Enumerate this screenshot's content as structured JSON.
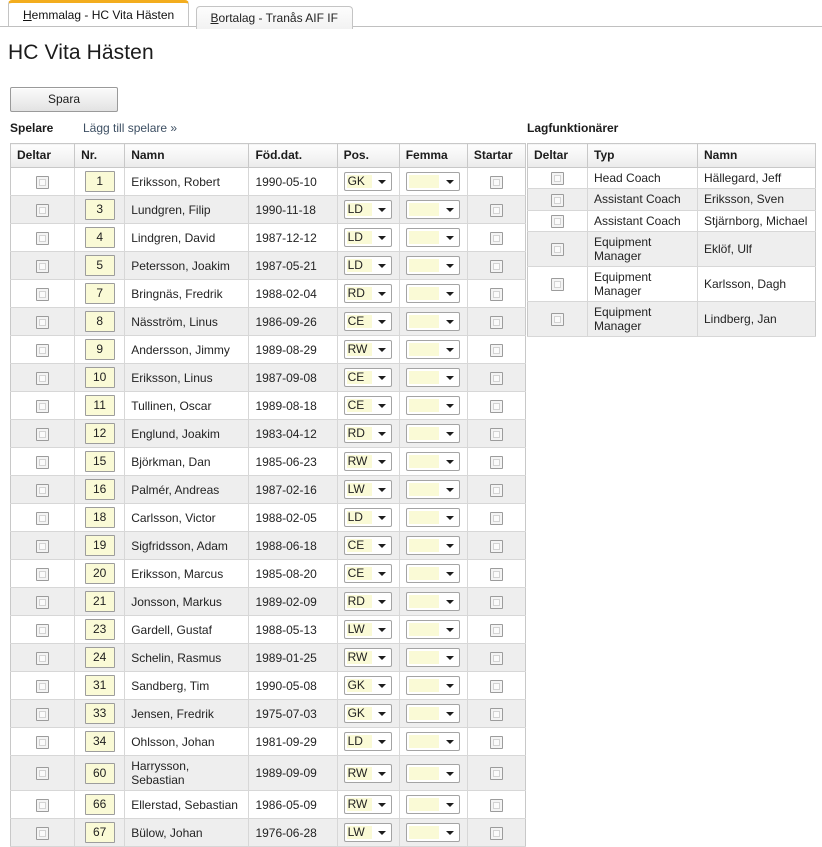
{
  "tabs": [
    {
      "name": "tab-home-team",
      "mnemonic": "H",
      "rest": "emmalag - HC Vita Hästen",
      "label": "Hemmalag - HC Vita Hästen",
      "active": true
    },
    {
      "name": "tab-away-team",
      "mnemonic": "B",
      "rest": "ortalag - Tranås AIF IF",
      "label": "Bortalag - Tranås AIF IF",
      "active": false
    }
  ],
  "page": {
    "title": "HC Vita Hästen",
    "save_label": "Spara",
    "players_heading": "Spelare",
    "add_player_link": "Lägg till spelare »",
    "officials_heading": "Lagfunktionärer"
  },
  "players_table": {
    "columns": [
      "Deltar",
      "Nr.",
      "Namn",
      "Föd.dat.",
      "Pos.",
      "Femma",
      "Startar"
    ],
    "rows": [
      {
        "nr": "1",
        "namn": "Eriksson, Robert",
        "fod": "1990-05-10",
        "pos": "GK",
        "femma": "",
        "deltar": false,
        "startar": false
      },
      {
        "nr": "3",
        "namn": "Lundgren, Filip",
        "fod": "1990-11-18",
        "pos": "LD",
        "femma": "",
        "deltar": false,
        "startar": false
      },
      {
        "nr": "4",
        "namn": "Lindgren, David",
        "fod": "1987-12-12",
        "pos": "LD",
        "femma": "",
        "deltar": false,
        "startar": false
      },
      {
        "nr": "5",
        "namn": "Petersson, Joakim",
        "fod": "1987-05-21",
        "pos": "LD",
        "femma": "",
        "deltar": false,
        "startar": false
      },
      {
        "nr": "7",
        "namn": "Bringnäs, Fredrik",
        "fod": "1988-02-04",
        "pos": "RD",
        "femma": "",
        "deltar": false,
        "startar": false
      },
      {
        "nr": "8",
        "namn": "Näsström, Linus",
        "fod": "1986-09-26",
        "pos": "CE",
        "femma": "",
        "deltar": false,
        "startar": false
      },
      {
        "nr": "9",
        "namn": "Andersson, Jimmy",
        "fod": "1989-08-29",
        "pos": "RW",
        "femma": "",
        "deltar": false,
        "startar": false
      },
      {
        "nr": "10",
        "namn": "Eriksson, Linus",
        "fod": "1987-09-08",
        "pos": "CE",
        "femma": "",
        "deltar": false,
        "startar": false
      },
      {
        "nr": "11",
        "namn": "Tullinen, Oscar",
        "fod": "1989-08-18",
        "pos": "CE",
        "femma": "",
        "deltar": false,
        "startar": false
      },
      {
        "nr": "12",
        "namn": "Englund, Joakim",
        "fod": "1983-04-12",
        "pos": "RD",
        "femma": "",
        "deltar": false,
        "startar": false
      },
      {
        "nr": "15",
        "namn": "Björkman, Dan",
        "fod": "1985-06-23",
        "pos": "RW",
        "femma": "",
        "deltar": false,
        "startar": false
      },
      {
        "nr": "16",
        "namn": "Palmér, Andreas",
        "fod": "1987-02-16",
        "pos": "LW",
        "femma": "",
        "deltar": false,
        "startar": false
      },
      {
        "nr": "18",
        "namn": "Carlsson, Victor",
        "fod": "1988-02-05",
        "pos": "LD",
        "femma": "",
        "deltar": false,
        "startar": false
      },
      {
        "nr": "19",
        "namn": "Sigfridsson, Adam",
        "fod": "1988-06-18",
        "pos": "CE",
        "femma": "",
        "deltar": false,
        "startar": false
      },
      {
        "nr": "20",
        "namn": "Eriksson, Marcus",
        "fod": "1985-08-20",
        "pos": "CE",
        "femma": "",
        "deltar": false,
        "startar": false
      },
      {
        "nr": "21",
        "namn": "Jonsson, Markus",
        "fod": "1989-02-09",
        "pos": "RD",
        "femma": "",
        "deltar": false,
        "startar": false
      },
      {
        "nr": "23",
        "namn": "Gardell, Gustaf",
        "fod": "1988-05-13",
        "pos": "LW",
        "femma": "",
        "deltar": false,
        "startar": false
      },
      {
        "nr": "24",
        "namn": "Schelin, Rasmus",
        "fod": "1989-01-25",
        "pos": "RW",
        "femma": "",
        "deltar": false,
        "startar": false
      },
      {
        "nr": "31",
        "namn": "Sandberg, Tim",
        "fod": "1990-05-08",
        "pos": "GK",
        "femma": "",
        "deltar": false,
        "startar": false
      },
      {
        "nr": "33",
        "namn": "Jensen, Fredrik",
        "fod": "1975-07-03",
        "pos": "GK",
        "femma": "",
        "deltar": false,
        "startar": false
      },
      {
        "nr": "34",
        "namn": "Ohlsson, Johan",
        "fod": "1981-09-29",
        "pos": "LD",
        "femma": "",
        "deltar": false,
        "startar": false
      },
      {
        "nr": "60",
        "namn": "Harrysson, Sebastian",
        "fod": "1989-09-09",
        "pos": "RW",
        "femma": "",
        "deltar": false,
        "startar": false
      },
      {
        "nr": "66",
        "namn": "Ellerstad, Sebastian",
        "fod": "1986-05-09",
        "pos": "RW",
        "femma": "",
        "deltar": false,
        "startar": false
      },
      {
        "nr": "67",
        "namn": "Bülow, Johan",
        "fod": "1976-06-28",
        "pos": "LW",
        "femma": "",
        "deltar": false,
        "startar": false
      }
    ]
  },
  "officials_table": {
    "columns": [
      "Deltar",
      "Typ",
      "Namn"
    ],
    "rows": [
      {
        "typ": "Head Coach",
        "namn": "Hällegard, Jeff",
        "deltar": false
      },
      {
        "typ": "Assistant Coach",
        "namn": "Eriksson, Sven",
        "deltar": false
      },
      {
        "typ": "Assistant Coach",
        "namn": "Stjärnborg, Michael",
        "deltar": false
      },
      {
        "typ": "Equipment Manager",
        "namn": "Eklöf, Ulf",
        "deltar": false
      },
      {
        "typ": "Equipment Manager",
        "namn": "Karlsson, Dagh",
        "deltar": false
      },
      {
        "typ": "Equipment Manager",
        "namn": "Lindberg, Jan",
        "deltar": false
      }
    ]
  },
  "colors": {
    "active_tab_accent": "#f3ad1e",
    "input_yellow": "#fafad6",
    "row_alt": "#eeeeee",
    "link": "#3d4f63"
  }
}
